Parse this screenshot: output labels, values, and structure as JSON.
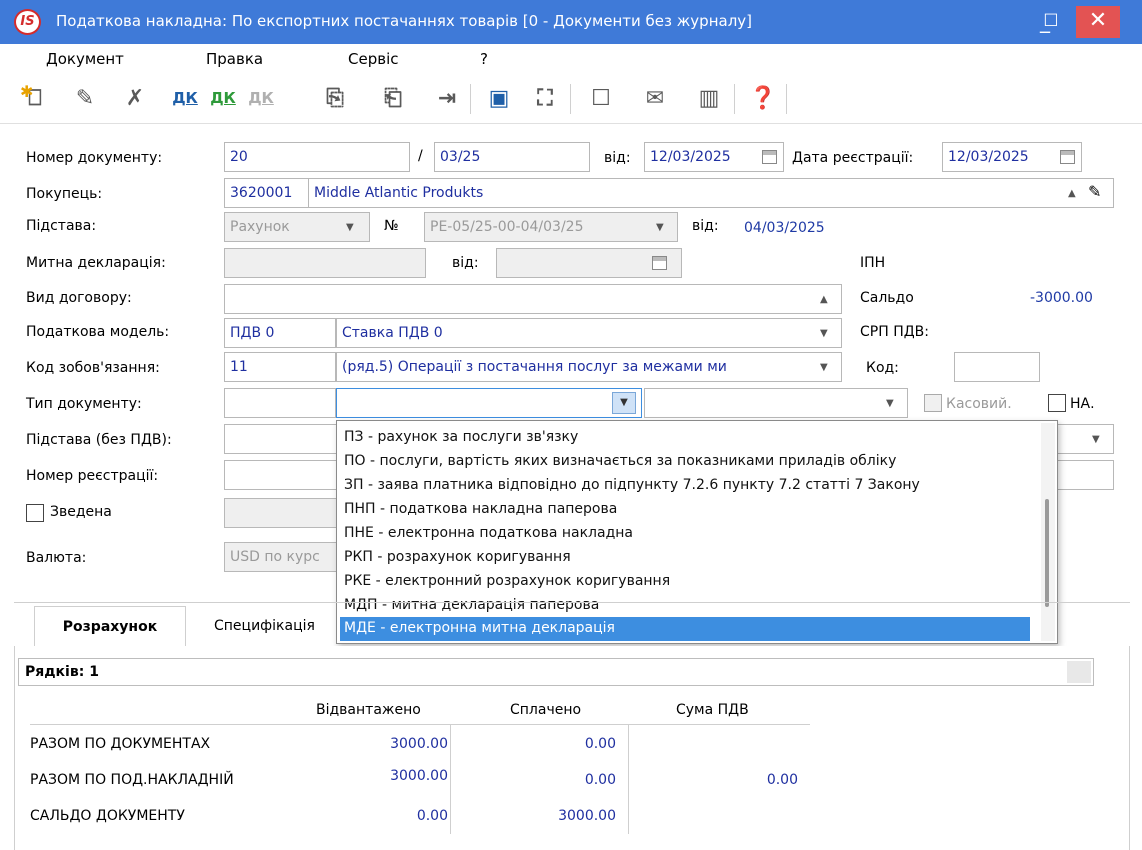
{
  "window": {
    "app_icon_text": "IS",
    "title": "Податкова накладна: По експортних  постачаннях товарів [0 - Документи без журналу]",
    "minimize_glyph": "_",
    "maximize_glyph": "☐",
    "close_glyph": "✕"
  },
  "menu": {
    "items": [
      "Документ",
      "Правка",
      "Сервіс",
      "?"
    ]
  },
  "toolbar": {
    "icons": [
      "new-doc-icon",
      "edit-doc-icon",
      "delete-doc-icon",
      "dk-entries-icon",
      "dk-post-icon",
      "dk-unpost-icon",
      "copy-doc-icon",
      "paste-doc-icon",
      "export-icon",
      "save-icon",
      "tree-icon",
      "form-icon",
      "mail-icon",
      "library-icon",
      "help-icon"
    ],
    "dk_label": "ДК"
  },
  "form": {
    "doc_number_label": "Номер документу:",
    "doc_number": "20",
    "doc_number_sep": "/",
    "doc_number_suffix": "03/25",
    "from_label": "від:",
    "doc_date": "12/03/2025",
    "reg_date_label": "Дата реєстрації:",
    "reg_date": "12/03/2025",
    "buyer_label": "Покупець:",
    "buyer_code": "3620001",
    "buyer_name": "Middle Atlantic Produkts",
    "basis_label": "Підстава:",
    "basis_value": "Рахунок",
    "number_sign": "№",
    "basis_number": "РЕ-05/25-00-04/03/25",
    "basis_from_label": "від:",
    "basis_date": "04/03/2025",
    "customs_label": "Митна декларація:",
    "customs_from_label": "від:",
    "ipn_label": "ІПН",
    "contract_type_label": "Вид договору:",
    "balance_label": "Сальдо",
    "balance_value": "-3000.00",
    "tax_model_label": "Податкова модель:",
    "tax_model_code": "ПДВ  0",
    "tax_model_name": "Ставка ПДВ 0",
    "srp_label": "СРП ПДВ:",
    "obligation_label": "Код зобов'язання:",
    "obligation_code": "11",
    "obligation_name": "(ряд.5) Операції з постачання послуг за межами ми",
    "code_label": "Код:",
    "doc_type_label": "Тип документу:",
    "cash_label": "Касовий.",
    "na_label": "НА.",
    "basis_no_vat_label": "Підстава (без ПДВ):",
    "reg_number_label": "Номер реєстрації:",
    "consolidated_label": "Зведена",
    "currency_label": "Валюта:",
    "currency_value": "USD по курс"
  },
  "doc_type_options": [
    "ПЗ - рахунок за послуги зв'язку",
    "ПО - послуги, вартість яких визначається за показниками приладів обліку",
    "ЗП - заява платника відповідно до підпункту 7.2.6 пункту 7.2 статті 7 Закону",
    "ПНП - податкова накладна паперова",
    "ПНЕ - електронна податкова накладна",
    "РКП - розрахунок  коригування",
    "РКЕ - електронний розрахунок коригування",
    "МДП - митна  декларація паперова",
    "МДЕ - електронна митна декларація"
  ],
  "selected_option_index": 8,
  "tabs": [
    "Розрахунок",
    "Специфікація"
  ],
  "summary": {
    "rows_label": "Рядків: 1",
    "columns": [
      "Відвантажено",
      "Сплачено",
      "Сума ПДВ"
    ],
    "rows": [
      {
        "label": "РАЗОМ ПО ДОКУМЕНТАХ",
        "shipped": "3000.00",
        "paid": "0.00",
        "vat": ""
      },
      {
        "label": "РАЗОМ ПО ПОД.НАКЛАДНІЙ",
        "shipped": "3000.00",
        "paid": "0.00",
        "vat": "0.00"
      },
      {
        "label": "САЛЬДО ДОКУМЕНТУ",
        "shipped": "0.00",
        "paid": "3000.00",
        "vat": ""
      }
    ]
  },
  "colors": {
    "titlebar": "#3f7ad8",
    "close_button": "#e35353",
    "selection": "#3d8ee0",
    "value_text": "#1f2fa0"
  }
}
